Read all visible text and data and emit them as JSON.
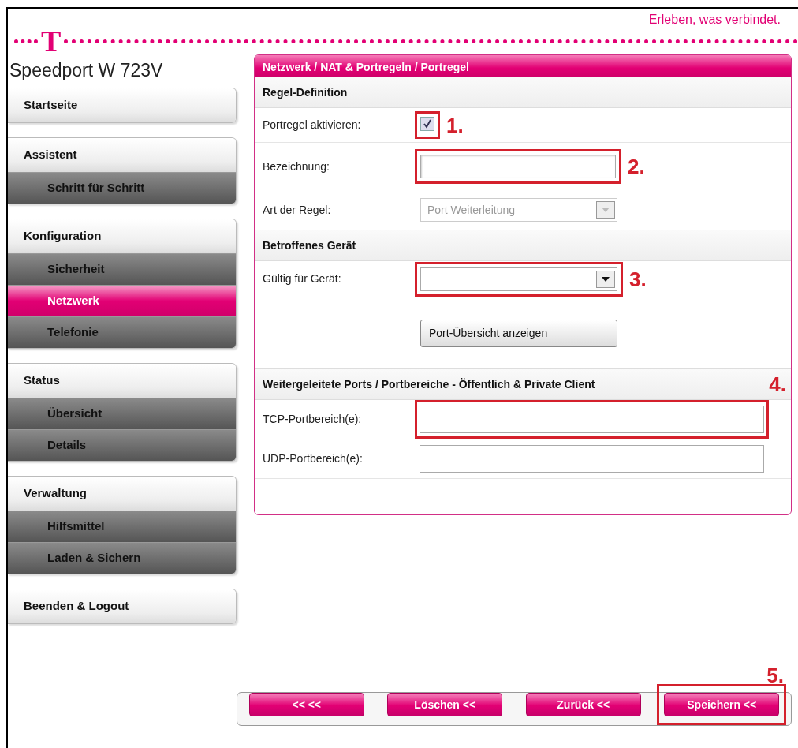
{
  "header": {
    "tagline": "Erleben, was verbindet.",
    "logo": "T"
  },
  "sidebar": {
    "title": "Speedport W 723V",
    "groups": [
      {
        "label": "Startseite",
        "selected": false
      },
      {
        "label": "Assistent",
        "selected": false,
        "children": [
          {
            "label": "Schritt für Schritt",
            "selected": false
          }
        ]
      },
      {
        "label": "Konfiguration",
        "selected": false,
        "children": [
          {
            "label": "Sicherheit",
            "selected": false
          },
          {
            "label": "Netzwerk",
            "selected": true
          },
          {
            "label": "Telefonie",
            "selected": false
          }
        ]
      },
      {
        "label": "Status",
        "selected": false,
        "children": [
          {
            "label": "Übersicht",
            "selected": false
          },
          {
            "label": "Details",
            "selected": false
          }
        ]
      },
      {
        "label": "Verwaltung",
        "selected": false,
        "children": [
          {
            "label": "Hilfsmittel",
            "selected": false
          },
          {
            "label": "Laden & Sichern",
            "selected": false
          }
        ]
      },
      {
        "label": "Beenden & Logout",
        "selected": false
      }
    ]
  },
  "panel": {
    "title": "Netzwerk / NAT & Portregeln / Portregel",
    "sections": [
      {
        "title": "Regel-Definition",
        "rows": [
          {
            "kind": "checkbox",
            "label": "Portregel aktivieren:",
            "checked": true,
            "highlighted": true,
            "callout": "1."
          },
          {
            "kind": "text",
            "label": "Bezeichnung:",
            "highlighted": true,
            "callout": "2."
          },
          {
            "kind": "select",
            "label": "Art der Regel:",
            "value": "Port Weiterleitung",
            "disabled": true,
            "highlighted": false
          }
        ]
      },
      {
        "title": "Betroffenes Gerät",
        "rows": [
          {
            "kind": "select",
            "label": "Gültig für Gerät:",
            "disabled": false,
            "highlighted": true,
            "callout": "3."
          },
          {
            "kind": "button",
            "label": "Port-Übersicht anzeigen"
          }
        ]
      },
      {
        "title": "Weitergeleitete Ports / Portbereiche - Öffentlich & Private Client",
        "callout": "4.",
        "rows": [
          {
            "kind": "wide-text",
            "label": "TCP-Portbereich(e):",
            "highlighted": true
          },
          {
            "kind": "wide-text",
            "label": "UDP-Portbereich(e):",
            "highlighted": false
          }
        ]
      }
    ]
  },
  "footer": {
    "callout": "5.",
    "buttons": [
      {
        "label": "<<  <<",
        "highlighted": false
      },
      {
        "label": "Löschen <<",
        "highlighted": false
      },
      {
        "label": "Zurück <<",
        "highlighted": false
      },
      {
        "label": "Speichern <<",
        "highlighted": true
      }
    ]
  }
}
